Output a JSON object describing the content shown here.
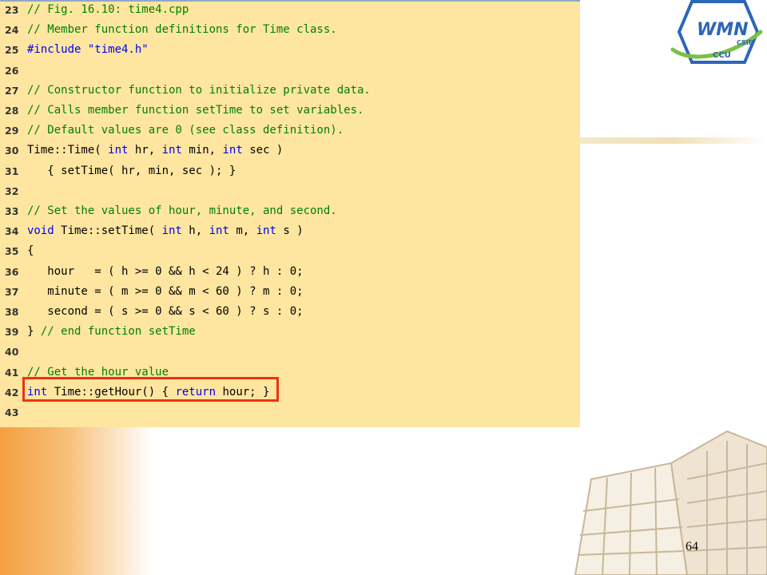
{
  "code": {
    "lines": [
      {
        "num": "23",
        "tokens": [
          {
            "cls": "c",
            "text": "// Fig. 16.10: time4.cpp"
          }
        ]
      },
      {
        "num": "24",
        "tokens": [
          {
            "cls": "c",
            "text": "// Member function definitions for Time class."
          }
        ]
      },
      {
        "num": "25",
        "tokens": [
          {
            "cls": "k",
            "text": "#include "
          },
          {
            "cls": "s",
            "text": "\"time4.h\""
          }
        ]
      },
      {
        "num": "26",
        "tokens": []
      },
      {
        "num": "27",
        "tokens": [
          {
            "cls": "c",
            "text": "// Constructor function to initialize private data."
          }
        ]
      },
      {
        "num": "28",
        "tokens": [
          {
            "cls": "c",
            "text": "// Calls member function setTime to set variables."
          }
        ]
      },
      {
        "num": "29",
        "tokens": [
          {
            "cls": "c",
            "text": "// Default values are 0 (see class definition)."
          }
        ]
      },
      {
        "num": "30",
        "tokens": [
          {
            "cls": "t",
            "text": "Time::Time( "
          },
          {
            "cls": "k",
            "text": "int"
          },
          {
            "cls": "t",
            "text": " hr, "
          },
          {
            "cls": "k",
            "text": "int"
          },
          {
            "cls": "t",
            "text": " min, "
          },
          {
            "cls": "k",
            "text": "int"
          },
          {
            "cls": "t",
            "text": " sec )"
          }
        ]
      },
      {
        "num": "31",
        "tokens": [
          {
            "cls": "t",
            "text": "   { setTime( hr, min, sec ); }"
          }
        ]
      },
      {
        "num": "32",
        "tokens": []
      },
      {
        "num": "33",
        "tokens": [
          {
            "cls": "c",
            "text": "// Set the values of hour, minute, and second."
          }
        ]
      },
      {
        "num": "34",
        "tokens": [
          {
            "cls": "k",
            "text": "void"
          },
          {
            "cls": "t",
            "text": " Time::setTime( "
          },
          {
            "cls": "k",
            "text": "int"
          },
          {
            "cls": "t",
            "text": " h, "
          },
          {
            "cls": "k",
            "text": "int"
          },
          {
            "cls": "t",
            "text": " m, "
          },
          {
            "cls": "k",
            "text": "int"
          },
          {
            "cls": "t",
            "text": " s )"
          }
        ]
      },
      {
        "num": "35",
        "tokens": [
          {
            "cls": "t",
            "text": "{"
          }
        ]
      },
      {
        "num": "36",
        "tokens": [
          {
            "cls": "t",
            "text": "   hour   = ( h >= 0 && h < 24 ) ? h : 0;"
          }
        ]
      },
      {
        "num": "37",
        "tokens": [
          {
            "cls": "t",
            "text": "   minute = ( m >= 0 && m < 60 ) ? m : 0;"
          }
        ]
      },
      {
        "num": "38",
        "tokens": [
          {
            "cls": "t",
            "text": "   second = ( s >= 0 && s < 60 ) ? s : 0;"
          }
        ]
      },
      {
        "num": "39",
        "tokens": [
          {
            "cls": "t",
            "text": "} "
          },
          {
            "cls": "c",
            "text": "// end function setTime"
          }
        ]
      },
      {
        "num": "40",
        "tokens": []
      },
      {
        "num": "41",
        "tokens": [
          {
            "cls": "c",
            "text": "// Get the hour value"
          }
        ]
      },
      {
        "num": "42",
        "tokens": [
          {
            "cls": "k",
            "text": "int"
          },
          {
            "cls": "t",
            "text": " Time::getHour() { "
          },
          {
            "cls": "k",
            "text": "return"
          },
          {
            "cls": "t",
            "text": " hour; }"
          }
        ]
      },
      {
        "num": "43",
        "tokens": []
      }
    ]
  },
  "logo": {
    "main_text": "WMN",
    "small_text": "CSIE",
    "bottom_text": "CCU"
  },
  "colors": {
    "panel_bg": "#ffe6a0",
    "comment": "#008000",
    "keyword": "#0000ee",
    "highlight": "#ee3311"
  },
  "page_number": "64"
}
